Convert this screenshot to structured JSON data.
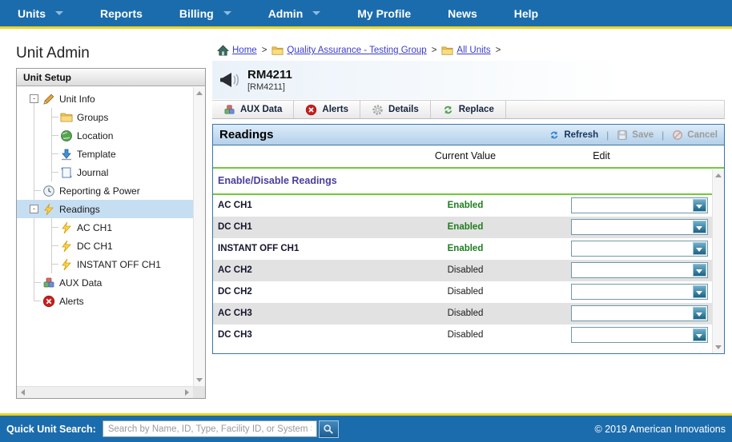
{
  "nav": {
    "items": [
      {
        "label": "Units",
        "has_dropdown": true
      },
      {
        "label": "Reports",
        "has_dropdown": false
      },
      {
        "label": "Billing",
        "has_dropdown": true
      },
      {
        "label": "Admin",
        "has_dropdown": true
      },
      {
        "label": "My Profile",
        "has_dropdown": false
      },
      {
        "label": "News",
        "has_dropdown": false
      },
      {
        "label": "Help",
        "has_dropdown": false
      }
    ]
  },
  "page_title": "Unit Admin",
  "sidebar": {
    "header": "Unit Setup",
    "tree": [
      {
        "label": "Unit Info",
        "icon": "pencil-icon",
        "level": 0,
        "expanded": true
      },
      {
        "label": "Groups",
        "icon": "folder-icon",
        "level": 1
      },
      {
        "label": "Location",
        "icon": "globe-icon",
        "level": 1
      },
      {
        "label": "Template",
        "icon": "download-icon",
        "level": 1
      },
      {
        "label": "Journal",
        "icon": "journal-icon",
        "level": 1
      },
      {
        "label": "Reporting & Power",
        "icon": "clock-icon",
        "level": 0
      },
      {
        "label": "Readings",
        "icon": "lightning-icon",
        "level": 0,
        "expanded": true,
        "selected": true
      },
      {
        "label": "AC CH1",
        "icon": "lightning-icon",
        "level": 1
      },
      {
        "label": "DC CH1",
        "icon": "lightning-icon",
        "level": 1
      },
      {
        "label": "INSTANT OFF CH1",
        "icon": "lightning-icon",
        "level": 1
      },
      {
        "label": "AUX Data",
        "icon": "cubes-icon",
        "level": 0
      },
      {
        "label": "Alerts",
        "icon": "alert-icon",
        "level": 0
      }
    ]
  },
  "breadcrumb": {
    "items": [
      {
        "label": "Home",
        "icon": "home-icon"
      },
      {
        "label": "Quality Assurance - Testing Group",
        "icon": "folder-icon"
      },
      {
        "label": "All Units",
        "icon": "folder-icon"
      }
    ],
    "separator": ">"
  },
  "unit": {
    "name": "RM4211",
    "id_display": "[RM4211]",
    "icon": "megaphone-icon"
  },
  "tabs": [
    {
      "label": "AUX Data",
      "icon": "cubes-icon"
    },
    {
      "label": "Alerts",
      "icon": "alert-icon"
    },
    {
      "label": "Details",
      "icon": "gear-icon"
    },
    {
      "label": "Replace",
      "icon": "replace-icon"
    }
  ],
  "readings": {
    "title": "Readings",
    "actions": {
      "refresh": "Refresh",
      "save": "Save",
      "cancel": "Cancel",
      "separator": "|"
    },
    "columns": {
      "current_value": "Current Value",
      "edit": "Edit"
    },
    "section": "Enable/Disable Readings",
    "rows": [
      {
        "label": "AC CH1",
        "value": "Enabled"
      },
      {
        "label": "DC CH1",
        "value": "Enabled"
      },
      {
        "label": "INSTANT OFF CH1",
        "value": "Enabled"
      },
      {
        "label": "AC CH2",
        "value": "Disabled"
      },
      {
        "label": "DC CH2",
        "value": "Disabled"
      },
      {
        "label": "AC CH3",
        "value": "Disabled"
      },
      {
        "label": "DC CH3",
        "value": "Disabled"
      }
    ]
  },
  "footer": {
    "search_label": "Quick Unit Search:",
    "search_placeholder": "Search by Name, ID, Type, Facility ID, or System Serial",
    "search_value": "",
    "copyright": "© 2019 American Innovations"
  },
  "colors": {
    "nav_blue": "#1b6cad",
    "accent_gold": "#eed51d",
    "panel_border_blue": "#3a74a8",
    "enabled_green": "#1e7d1e",
    "section_purple": "#4a3f99",
    "divider_green": "#6fcb3a",
    "link_blue": "#3b3bcd",
    "selected_row_blue": "#c6def2"
  }
}
